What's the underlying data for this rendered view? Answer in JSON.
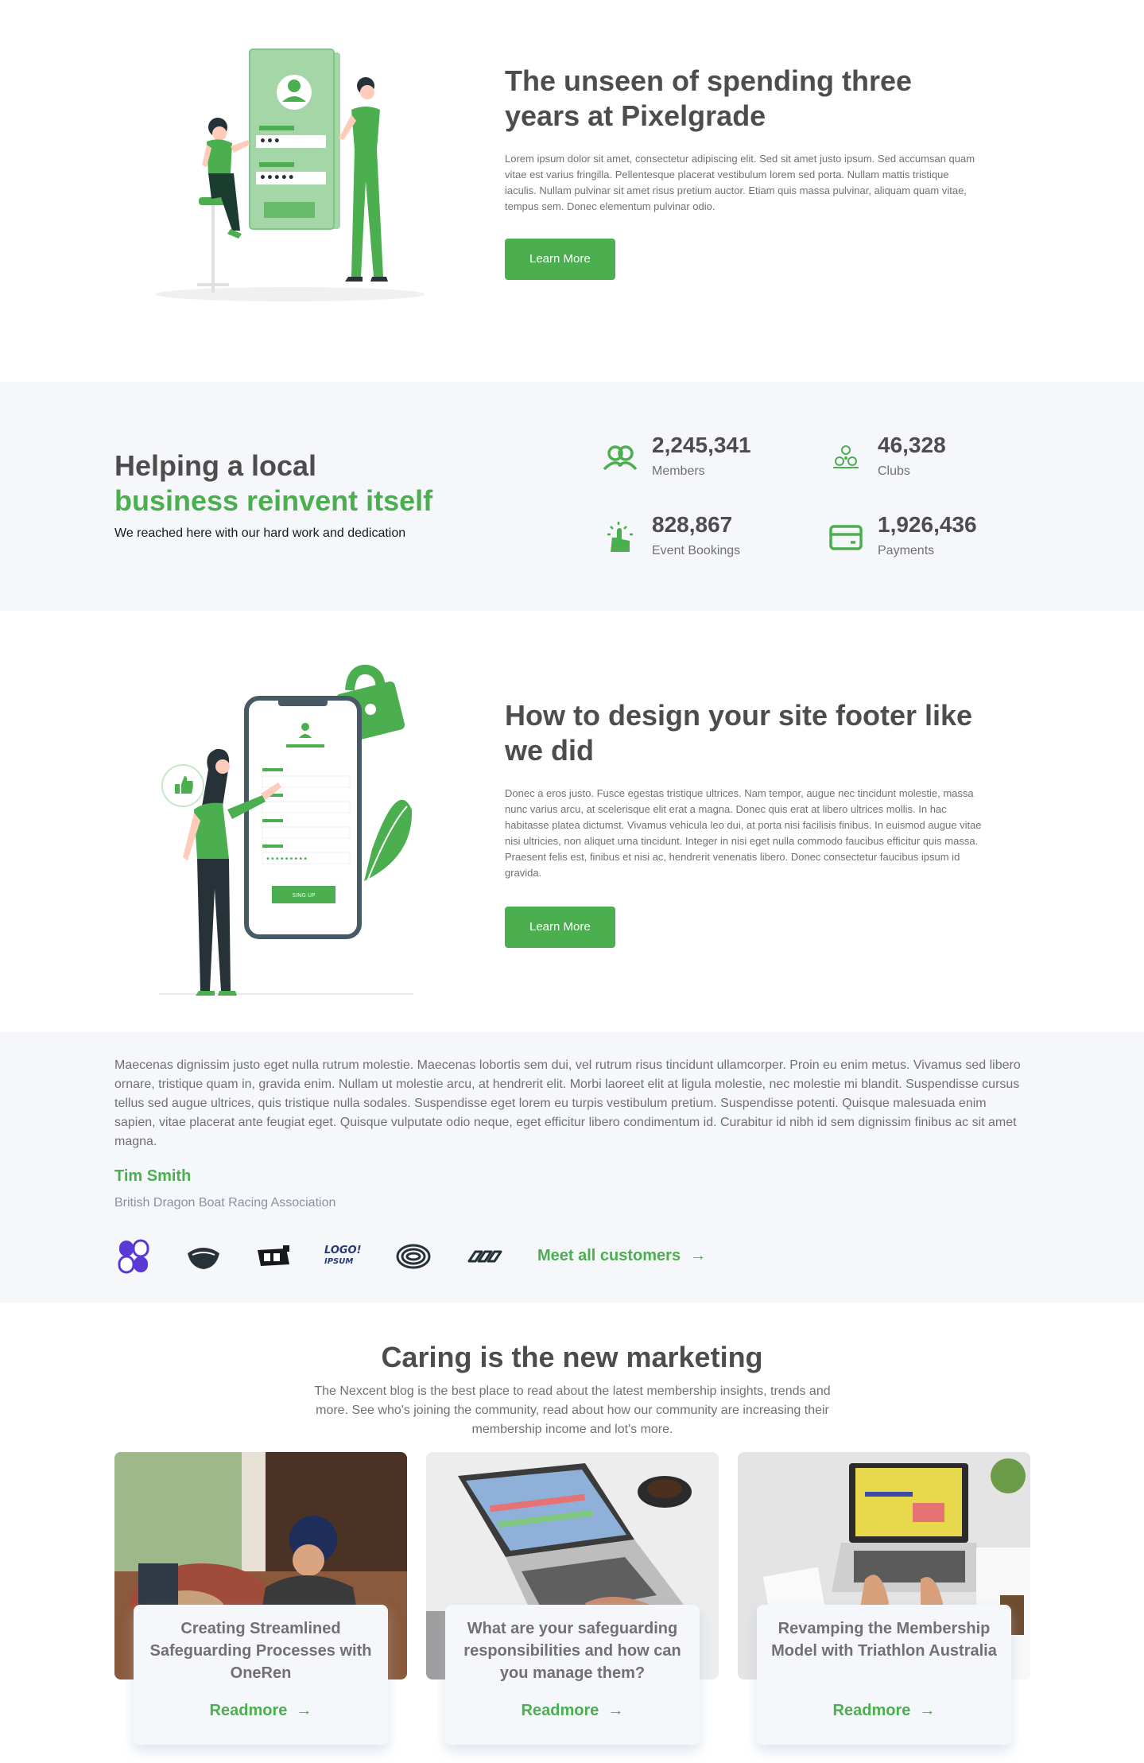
{
  "section1": {
    "title": "The unseen of spending three years at Pixelgrade",
    "body": "Lorem ipsum dolor sit amet, consectetur adipiscing elit. Sed sit amet justo ipsum. Sed accumsan quam vitae est varius fringilla. Pellentesque placerat vestibulum lorem sed porta. Nullam mattis tristique iaculis. Nullam pulvinar sit amet risus pretium auctor. Etiam quis massa pulvinar, aliquam quam vitae, tempus sem. Donec elementum pulvinar odio.",
    "button": "Learn More",
    "illustration": {
      "password_dots_1": "•••",
      "password_dots_2": "•••••"
    }
  },
  "stats": {
    "title_line1": "Helping a local",
    "title_line2": "business reinvent itself",
    "subtitle": "We reached here with our hard work and dedication",
    "items": [
      {
        "value": "2,245,341",
        "label": "Members",
        "icon": "members-icon"
      },
      {
        "value": "46,328",
        "label": "Clubs",
        "icon": "clubs-icon"
      },
      {
        "value": "828,867",
        "label": "Event Bookings",
        "icon": "event-bookings-icon"
      },
      {
        "value": "1,926,436",
        "label": "Payments",
        "icon": "payments-icon"
      }
    ]
  },
  "section3": {
    "title": "How to design your site footer like we did",
    "body": "Donec a eros justo. Fusce egestas tristique ultrices. Nam tempor, augue nec tincidunt molestie, massa nunc varius arcu, at scelerisque elit erat a magna. Donec quis erat at libero ultrices mollis. In hac habitasse platea dictumst. Vivamus vehicula leo dui, at porta nisi facilisis finibus. In euismod augue vitae nisi ultricies, non aliquet urna tincidunt. Integer in nisi eget nulla commodo faucibus efficitur quis massa. Praesent felis est, finibus et nisi ac, hendrerit venenatis libero. Donec consectetur faucibus ipsum id gravida.",
    "button": "Learn More",
    "illustration": {
      "password_dots": "•••••••••",
      "phone_button": "SING UP"
    }
  },
  "testimonial": {
    "quote": "Maecenas dignissim justo eget nulla rutrum molestie. Maecenas lobortis sem dui, vel rutrum risus tincidunt ullamcorper. Proin eu enim metus. Vivamus sed libero ornare, tristique quam in, gravida enim. Nullam ut molestie arcu, at hendrerit elit. Morbi laoreet elit at ligula molestie, nec molestie mi blandit. Suspendisse cursus tellus sed augue ultrices, quis tristique nulla sodales. Suspendisse eget lorem eu turpis vestibulum pretium. Suspendisse potenti. Quisque malesuada enim sapien, vitae placerat ante feugiat eget. Quisque vulputate odio neque, eget efficitur libero condimentum id. Curabitur id nibh id sem dignissim finibus ac sit amet magna.",
    "name": "Tim Smith",
    "organization": "British Dragon Boat Racing Association",
    "meet_link": "Meet all customers",
    "arrow": "→",
    "logo_text": {
      "line1": "LOGO!",
      "line2": "IPSUM"
    }
  },
  "blog": {
    "title": "Caring is the new marketing",
    "description": "The Nexcent blog is the best place to read about the latest membership insights, trends and more. See who's joining the community, read about how our community are increasing their membership income and lot's more.",
    "cards": [
      {
        "title": "Creating Streamlined Safeguarding Processes with OneRen",
        "link": "Readmore"
      },
      {
        "title": "What are your safeguarding responsibilities and how can you manage them?",
        "link": "Readmore"
      },
      {
        "title": "Revamping the Membership Model with Triathlon Australia",
        "link": "Readmore"
      }
    ],
    "arrow": "→"
  },
  "colors": {
    "primary": "#4CAF4F",
    "heading": "#4D4D4D",
    "muted": "#717171",
    "silver": "#F5F7FA"
  }
}
